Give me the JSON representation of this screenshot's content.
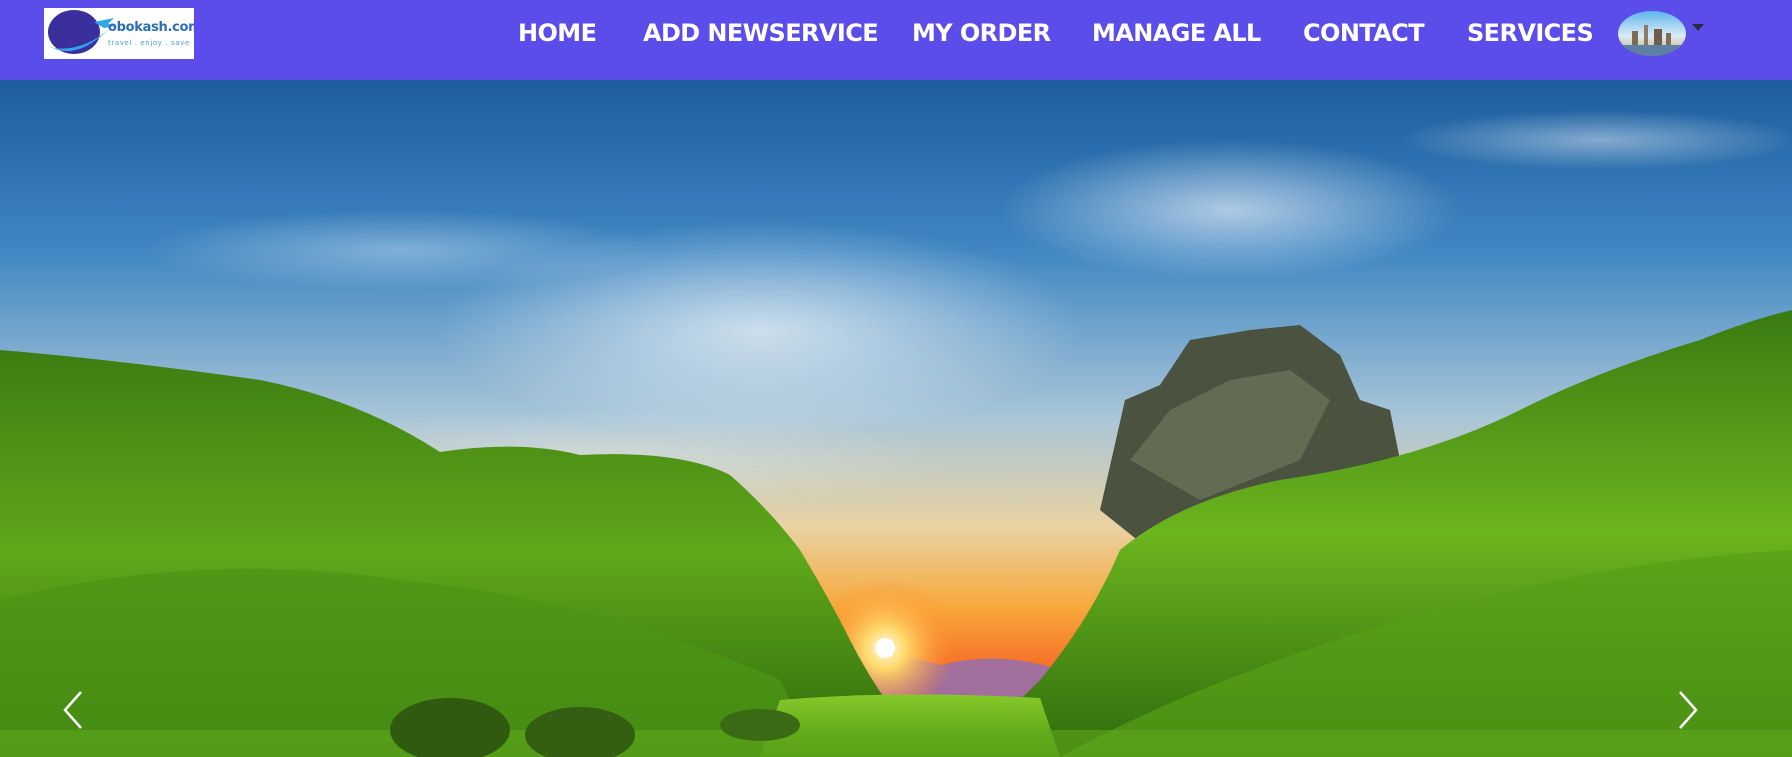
{
  "brand": {
    "name": "obokash.com",
    "tagline": "travel . enjoy . save",
    "colors": {
      "navbar": "#5b4de9",
      "logo_globe": "#3b2f9e",
      "logo_swoosh": "#2ea6e8"
    }
  },
  "nav": {
    "items": [
      {
        "label": "HOME"
      },
      {
        "label": "ADD NEWSERVICE"
      },
      {
        "label": "MY ORDER"
      },
      {
        "label": "MANAGE ALL"
      },
      {
        "label": "CONTACT"
      },
      {
        "label": "SERVICES"
      }
    ],
    "user_menu": {
      "avatar_icon": "user-avatar",
      "caret_icon": "caret-down-icon"
    }
  },
  "carousel": {
    "slide_image": "green valley sunset landscape",
    "prev_icon": "chevron-left-icon",
    "next_icon": "chevron-right-icon"
  }
}
